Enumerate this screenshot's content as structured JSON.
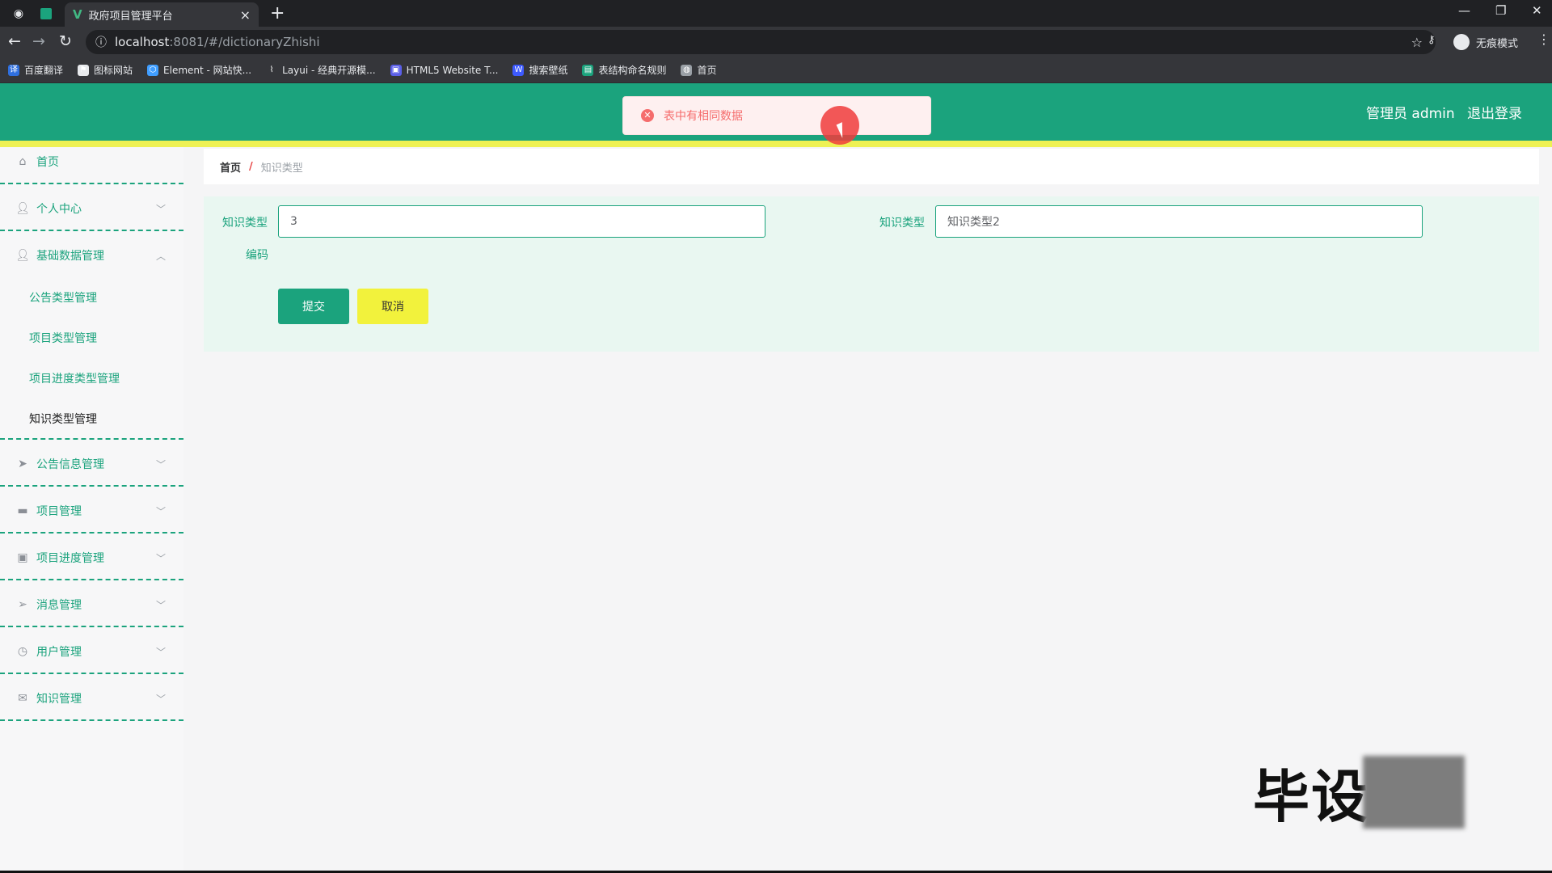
{
  "browser": {
    "tab_title": "政府项目管理平台",
    "url_host": "localhost",
    "url_path": ":8081/#/dictionaryZhishi",
    "incognito_label": "无痕模式",
    "bookmarks": [
      {
        "label": "百度翻译",
        "color": "#2f6fde",
        "glyph": "译"
      },
      {
        "label": "图标网站",
        "color": "#e8eaed",
        "glyph": "⚑"
      },
      {
        "label": "Element - 网站快...",
        "color": "#409eff",
        "glyph": "⬡"
      },
      {
        "label": "Layui - 经典开源模...",
        "color": "#35363a",
        "glyph": "⌇"
      },
      {
        "label": "HTML5 Website T...",
        "color": "#5b5fe8",
        "glyph": "▣"
      },
      {
        "label": "搜索壁纸",
        "color": "#3d5afe",
        "glyph": "W"
      },
      {
        "label": "表结构命名规则",
        "color": "#1ba37d",
        "glyph": "▤"
      },
      {
        "label": "首页",
        "color": "#9aa0a6",
        "glyph": "◍"
      }
    ]
  },
  "header": {
    "user_label": "管理员 admin",
    "logout_label": "退出登录",
    "toast_message": "表中有相同数据"
  },
  "sidebar": {
    "items": [
      {
        "label": "首页",
        "icon": "home-icon"
      },
      {
        "label": "个人中心",
        "icon": "user-icon"
      },
      {
        "label": "基础数据管理",
        "icon": "user-icon"
      },
      {
        "label": "公告信息管理",
        "icon": "send-icon"
      },
      {
        "label": "项目管理",
        "icon": "chat-icon"
      },
      {
        "label": "项目进度管理",
        "icon": "clipboard-icon"
      },
      {
        "label": "消息管理",
        "icon": "navigation-icon"
      },
      {
        "label": "用户管理",
        "icon": "clock-icon"
      },
      {
        "label": "知识管理",
        "icon": "mail-icon"
      }
    ],
    "sub_items": [
      {
        "label": "公告类型管理"
      },
      {
        "label": "项目类型管理"
      },
      {
        "label": "项目进度类型管理"
      },
      {
        "label": "知识类型管理"
      }
    ]
  },
  "breadcrumb": {
    "home": "首页",
    "separator": "/",
    "current": "知识类型"
  },
  "form": {
    "field1_label": "知识类型",
    "field1_label2": "编码",
    "field1_value": "3",
    "field2_label": "知识类型",
    "field2_value": "知识类型2",
    "submit_label": "提交",
    "cancel_label": "取消"
  },
  "watermark": {
    "text": "毕设"
  }
}
